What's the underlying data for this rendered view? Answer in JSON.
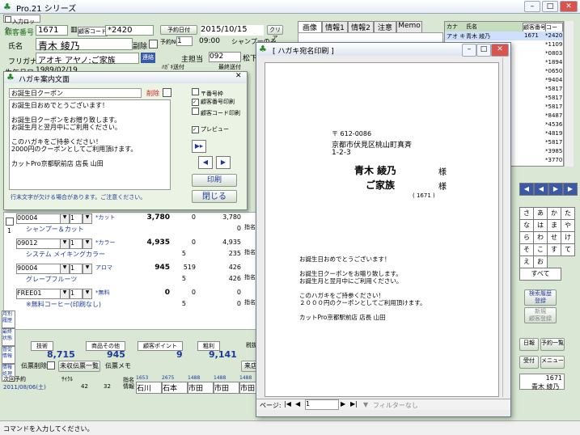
{
  "app": {
    "title": "Pro.21 シリーズ",
    "input_lock": "入力ロック"
  },
  "customer": {
    "code_label": "顧客番号",
    "code": "1671",
    "code_kbn_label": "顧客コード",
    "code2": "*2420",
    "reserve_label": "予約日付",
    "date": "2015/10/15",
    "clear": "クリア",
    "name_label": "氏名",
    "name": "青木 綾乃",
    "delete_label": "副除",
    "furigana_label": "フリガナ",
    "furigana": "アオキ アヤノ:ご家族",
    "renraku": "連絡",
    "birth_label": "生年月日",
    "birth": "1989/02/19",
    "yotei_label": "予約No",
    "yotei": "1",
    "time": "09:00",
    "menu": "シャンプーのみ",
    "shuri_label": "主担当",
    "shuri": "092",
    "shuri_name": "松下",
    "hagaki_label": "ﾊｶﾞｷ送付",
    "saishu_label": "最終送付"
  },
  "tabs": [
    "画像",
    "情報1",
    "情報2",
    "注意",
    "Memo"
  ],
  "right_list": {
    "headers": [
      "カナ",
      "氏名",
      "顧客番号",
      "コード"
    ],
    "rows": [
      [
        "アオ キ",
        "青木 綾乃",
        "1671",
        "*2420"
      ],
      [
        "",
        "",
        "",
        "*1109"
      ],
      [
        "",
        "",
        "",
        "*0803"
      ],
      [
        "",
        "",
        "",
        "*1894"
      ],
      [
        "",
        "",
        "",
        "*0650"
      ],
      [
        "",
        "",
        "",
        "*9404"
      ],
      [
        "",
        "",
        "",
        "*5817"
      ],
      [
        "",
        "",
        "",
        "*5817"
      ],
      [
        "",
        "",
        "",
        "*5817"
      ],
      [
        "",
        "",
        "",
        "*8487"
      ],
      [
        "",
        "",
        "",
        "*4536"
      ],
      [
        "",
        "",
        "",
        "*4819"
      ],
      [
        "",
        "",
        "",
        "*5817"
      ],
      [
        "",
        "",
        "",
        "*3985"
      ],
      [
        "",
        "",
        "",
        "*3770"
      ]
    ]
  },
  "kana": [
    "さ",
    "あ",
    "か",
    "た",
    "な",
    "は",
    "ま",
    "や",
    "ら",
    "わ",
    "せ",
    "け",
    "そ",
    "こ",
    "す",
    "て",
    "え",
    "お",
    "すべて"
  ],
  "right_buttons": {
    "history": "検索履歴\n登録",
    "new_customer": "新規\n顧客登録",
    "date_btn": "日報",
    "list": "予約一覧",
    "receipt": "受付",
    "menu": "メニュー"
  },
  "hagaki_dialog": {
    "title": "ハガキ案内文面",
    "subject": "お誕生日クーポン",
    "delete": "削除",
    "body": "お誕生日おめでとうございます！\n\nお誕生日クーポンをお贈り致します。\nお誕生月と翌月中にご利用ください。\n\nこのハガキをご持参ください！\n2000円のクーポンとしてご利用頂けます。\n\nカットPro京都駅前店 店長 山田",
    "chk_postal": "〒番号枠",
    "chk_number": "顧客番号印刷",
    "chk_code": "顧客コード印刷",
    "chk_preview": "プレビュー",
    "print": "印刷",
    "close": "閉じる",
    "warning": "行末文字が欠ける場合があります。ご注意ください。"
  },
  "items": [
    {
      "code": "00004",
      "qty": "1",
      "cat": "*カット",
      "price": "3,780",
      "pts": "0",
      "total": "3,780",
      "name": "シャンプー＆カット",
      "disc": "",
      "sub": "0"
    },
    {
      "code": "09012",
      "qty": "1",
      "cat": "*カラー",
      "price": "4,935",
      "pts": "0",
      "total": "4,935",
      "name": "システム メイキングカラー",
      "disc": "5",
      "sub": "235"
    },
    {
      "code": "90004",
      "qty": "1",
      "cat": "アロマ",
      "price": "945",
      "pts": "519",
      "total": "426",
      "name": "グレープフルーツ",
      "disc": "5",
      "sub": "426"
    },
    {
      "code": "FREE01",
      "qty": "1",
      "cat": "*無料",
      "price": "0",
      "pts": "0",
      "total": "0",
      "name": "※無料コーヒー(印刷なし)",
      "disc": "5",
      "sub": "0"
    }
  ],
  "item_side": [
    "指名",
    "指名",
    "指名",
    "指名"
  ],
  "left_labels": [
    "月別\n履歴",
    "最終\n状態",
    "督促\n情報",
    "情報\n処理"
  ],
  "totals": {
    "tech_label": "技術",
    "goods_label": "商品その他",
    "pts_label": "顧客ポイント",
    "sum_label": "粗利",
    "tax_label": "税抜",
    "tech": "8,715",
    "goods": "945",
    "pts": "9",
    "sum": "9,141"
  },
  "denpyo": {
    "del": "伝票削除",
    "list": "未収伝票一覧",
    "memo": "伝票メモ",
    "raiten": "来店"
  },
  "bottom": {
    "next_label": "次回予約",
    "next_date": "2011/08/06(土)",
    "cycle": "ｻｲｸﾙ",
    "cycle_val": "42",
    "cycle2": "32",
    "shimei": "指名\n情報",
    "staff": [
      "石川",
      "石本",
      "市田",
      "市田",
      "市田"
    ],
    "staff_codes": [
      "1653",
      "2675",
      "1488",
      "1488",
      "1488"
    ],
    "right_name": "青木 綾乃",
    "right_code": "1671"
  },
  "status": "コマンドを入力してください。",
  "preview": {
    "title": "[ ハガキ宛名印刷 ]",
    "zip": "〒 612-0086",
    "addr1": "京都市伏見区桃山町真斉",
    "addr2": "1-2-3",
    "name1": "青木 綾乃",
    "sama": "様",
    "name2": "ご家族",
    "code": "( 1671 )",
    "body": "お誕生日おめでとうございます！\n\nお誕生日クーポンをお贈り致します。\nお誕生月と翌月中にご利用ください。\n\nこのハガキをご持参ください！\n２０００円のクーポンとしてご利用頂けます。\n\nカットPro京都駅前店 店長 山田",
    "page_label": "ページ:",
    "page": "1",
    "filter": "フィルターなし"
  }
}
